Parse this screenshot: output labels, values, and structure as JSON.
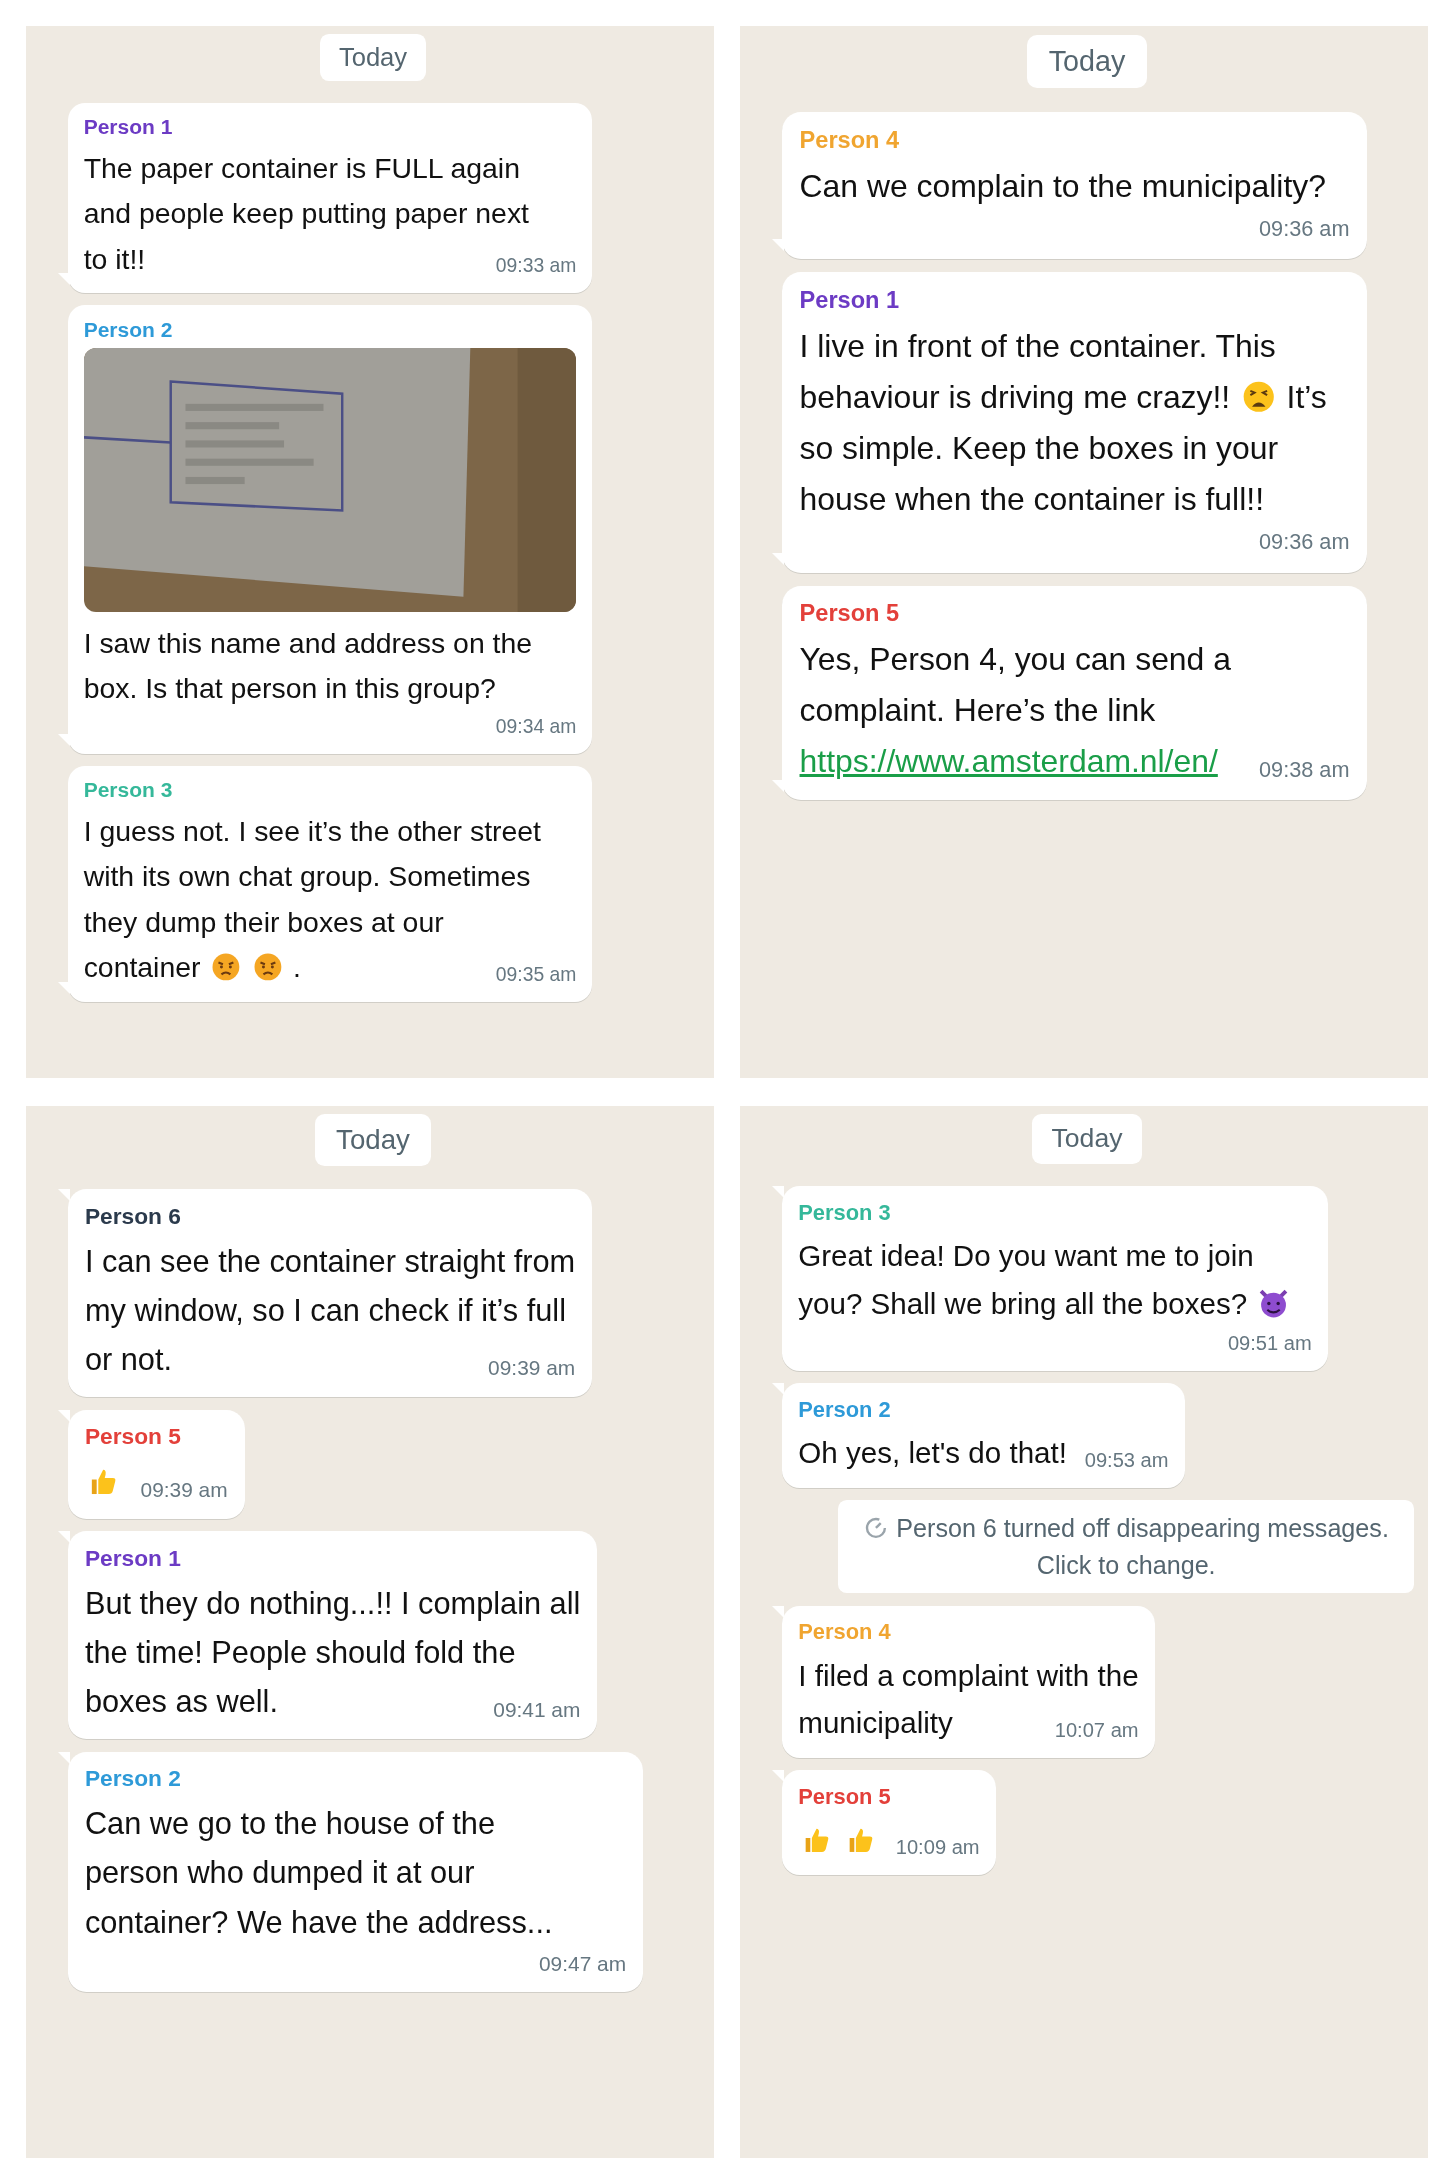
{
  "panels": [
    {
      "date": "Today",
      "messages": [
        {
          "kind": "message",
          "sender": "Person 1",
          "color": "#6c3bc4",
          "lines": [
            "The paper container is FULL again",
            "and people keep putting paper next",
            "to it!!"
          ],
          "time": "09:33 am"
        },
        {
          "kind": "message",
          "sender": "Person 2",
          "color": "#2e9ad8",
          "media": {
            "kind": "picture"
          },
          "lines": [
            "I saw this name and address on the",
            "box. Is that person in this group?"
          ],
          "time": "09:34 am"
        },
        {
          "kind": "message",
          "sender": "Person 3",
          "color": "#35b89a",
          "lines": [
            "I guess not. I see it’s the other street",
            "with its own chat group. Sometimes",
            "they dump their boxes at our",
            [
              {
                "kind": "text",
                "text": "container"
              },
              {
                "kind": "angry"
              },
              {
                "kind": "angry"
              },
              {
                "kind": "text",
                "text": "."
              }
            ]
          ],
          "time": "09:35 am"
        }
      ]
    },
    {
      "date": "Today",
      "messages": [
        {
          "kind": "message",
          "sender": "Person 4",
          "color": "#f0a530",
          "lines": [
            "Can we complain to the municipality?"
          ],
          "time": "09:36 am"
        },
        {
          "kind": "message",
          "sender": "Person 1",
          "color": "#6c3bc4",
          "lines": [
            "I live in front of the container. This",
            [
              {
                "kind": "text",
                "text": "behaviour is driving me crazy!!"
              },
              {
                "kind": "weary"
              },
              {
                "kind": "text",
                "text": "It’s"
              }
            ],
            "so simple. Keep the boxes in your",
            "house when the container is full!!"
          ],
          "time": "09:36 am"
        },
        {
          "kind": "message",
          "sender": "Person 5",
          "color": "#e3403a",
          "lines": [
            "Yes, Person 4, you can send a",
            "complaint. Here’s the link",
            [
              {
                "kind": "link",
                "text": "https://www.amsterdam.nl/en/"
              }
            ]
          ],
          "time": "09:38 am"
        }
      ]
    },
    {
      "date": "Today",
      "messages": [
        {
          "kind": "message",
          "sender": "Person 6",
          "color": "#2b3a4c",
          "lines": [
            "I can see the container straight from",
            "my window, so I can check if it’s full",
            "or not."
          ],
          "time": "09:39 am"
        },
        {
          "kind": "message",
          "sender": "Person 5",
          "color": "#e3403a",
          "lines": [
            [
              {
                "kind": "thumb"
              }
            ]
          ],
          "time": "09:39 am"
        },
        {
          "kind": "message",
          "sender": "Person 1",
          "color": "#6c3bc4",
          "lines": [
            "But they do nothing...!! I complain all",
            "the time! People should fold the",
            "boxes as well."
          ],
          "time": "09:41 am"
        },
        {
          "kind": "message",
          "sender": "Person 2",
          "color": "#2e9ad8",
          "lines": [
            "Can we go to the house of the",
            "person who dumped it at our",
            "container? We have the address..."
          ],
          "time": "09:47 am"
        }
      ]
    },
    {
      "date": "Today",
      "messages": [
        {
          "kind": "message",
          "sender": "Person 3",
          "color": "#35b89a",
          "lines": [
            "Great idea! Do you want me to join",
            [
              {
                "kind": "text",
                "text": "you? Shall we bring all the boxes?"
              },
              {
                "kind": "devil"
              }
            ]
          ],
          "time": "09:51 am"
        },
        {
          "kind": "message",
          "sender": "Person 2",
          "color": "#2e9ad8",
          "lines": [
            "Oh yes, let's do that!"
          ],
          "time": "09:53 am"
        },
        {
          "kind": "system",
          "lines": [
            "Person 6 turned off disappearing messages.",
            "Click to change."
          ]
        },
        {
          "kind": "message",
          "sender": "Person 4",
          "color": "#f0a530",
          "lines": [
            "I filed a complaint with the",
            "municipality"
          ],
          "time": "10:07 am"
        },
        {
          "kind": "message",
          "sender": "Person 5",
          "color": "#e3403a",
          "lines": [
            [
              {
                "kind": "thumb"
              },
              {
                "kind": "thumb"
              }
            ]
          ],
          "time": "10:09 am"
        }
      ]
    }
  ]
}
